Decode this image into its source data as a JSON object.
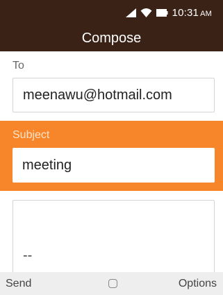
{
  "status_bar": {
    "time": "10:31",
    "am_pm": "AM",
    "icons": [
      "signal-icon",
      "wifi-icon",
      "battery-icon"
    ]
  },
  "header": {
    "title": "Compose"
  },
  "form": {
    "to_label": "To",
    "to_value": "meenawu@hotmail.com",
    "subject_label": "Subject",
    "subject_value": "meeting",
    "body_signature": "--"
  },
  "softkeys": {
    "left": "Send",
    "center_icon": "select-circle-icon",
    "right": "Options"
  },
  "colors": {
    "header_bg": "#3b2217",
    "accent": "#f7862a",
    "softkey_bg": "#eeeeee"
  }
}
